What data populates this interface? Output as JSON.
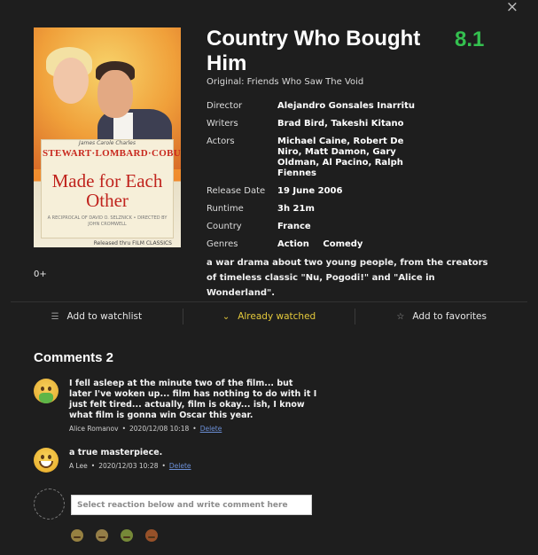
{
  "close_icon": "×",
  "poster": {
    "billing_small": "James  Carole  Charles",
    "billing": "STEWART·LOMBARD·COBURN",
    "title_text": "Made for Each Other",
    "credits": "A RECIPROCAL OF DAVID O. SELZNICK • DIRECTED BY JOHN CROMWELL",
    "footer": "Released thru FILM CLASSICS"
  },
  "age_rating": "0+",
  "movie": {
    "title": "Country Who Bought Him",
    "rating": "8.1",
    "original": "Original: Friends Who Saw The Void",
    "description": "a war drama about two young people, from the creators of timeless classic \"Nu, Pogodi!\" and \"Alice in Wonderland\"."
  },
  "info": {
    "director_label": "Director",
    "director": "Alejandro Gonsales Inarritu",
    "writers_label": "Writers",
    "writers": "Brad Bird, Takeshi Kitano",
    "actors_label": "Actors",
    "actors": "Michael Caine, Robert De Niro, Matt Damon, Gary Oldman, Al Pacino, Ralph Fiennes",
    "release_label": "Release Date",
    "release": "19 June 2006",
    "runtime_label": "Runtime",
    "runtime": "3h 21m",
    "country_label": "Country",
    "country": "France",
    "genres_label": "Genres",
    "genres": [
      "Action",
      "Comedy"
    ]
  },
  "actions": {
    "watchlist": "Add to watchlist",
    "watched": "Already watched",
    "favorites": "Add to favorites",
    "accent_color": "#e4c93b"
  },
  "comments": {
    "heading": "Comments 2",
    "items": [
      {
        "text": "I fell asleep at the minute two of the film... but later I've woken up... film has nothing to do with it I just felt tired... actually, film is okay... ish, I know what film is gonna win Oscar this year.",
        "author": "Alice Romanov",
        "date": "2020/12/08 10:18",
        "delete": "Delete",
        "reaction": "nauseated-face-icon"
      },
      {
        "text": "a true masterpiece.",
        "author": "A Lee",
        "date": "2020/12/03 10:28",
        "delete": "Delete",
        "reaction": "grinning-face-icon"
      }
    ],
    "input_placeholder": "Select reaction below and write comment here",
    "reactions": [
      "neutral-face-icon",
      "sleepy-face-icon",
      "nauseated-face-icon",
      "angry-face-icon"
    ]
  },
  "rating_color": "#34c04f"
}
